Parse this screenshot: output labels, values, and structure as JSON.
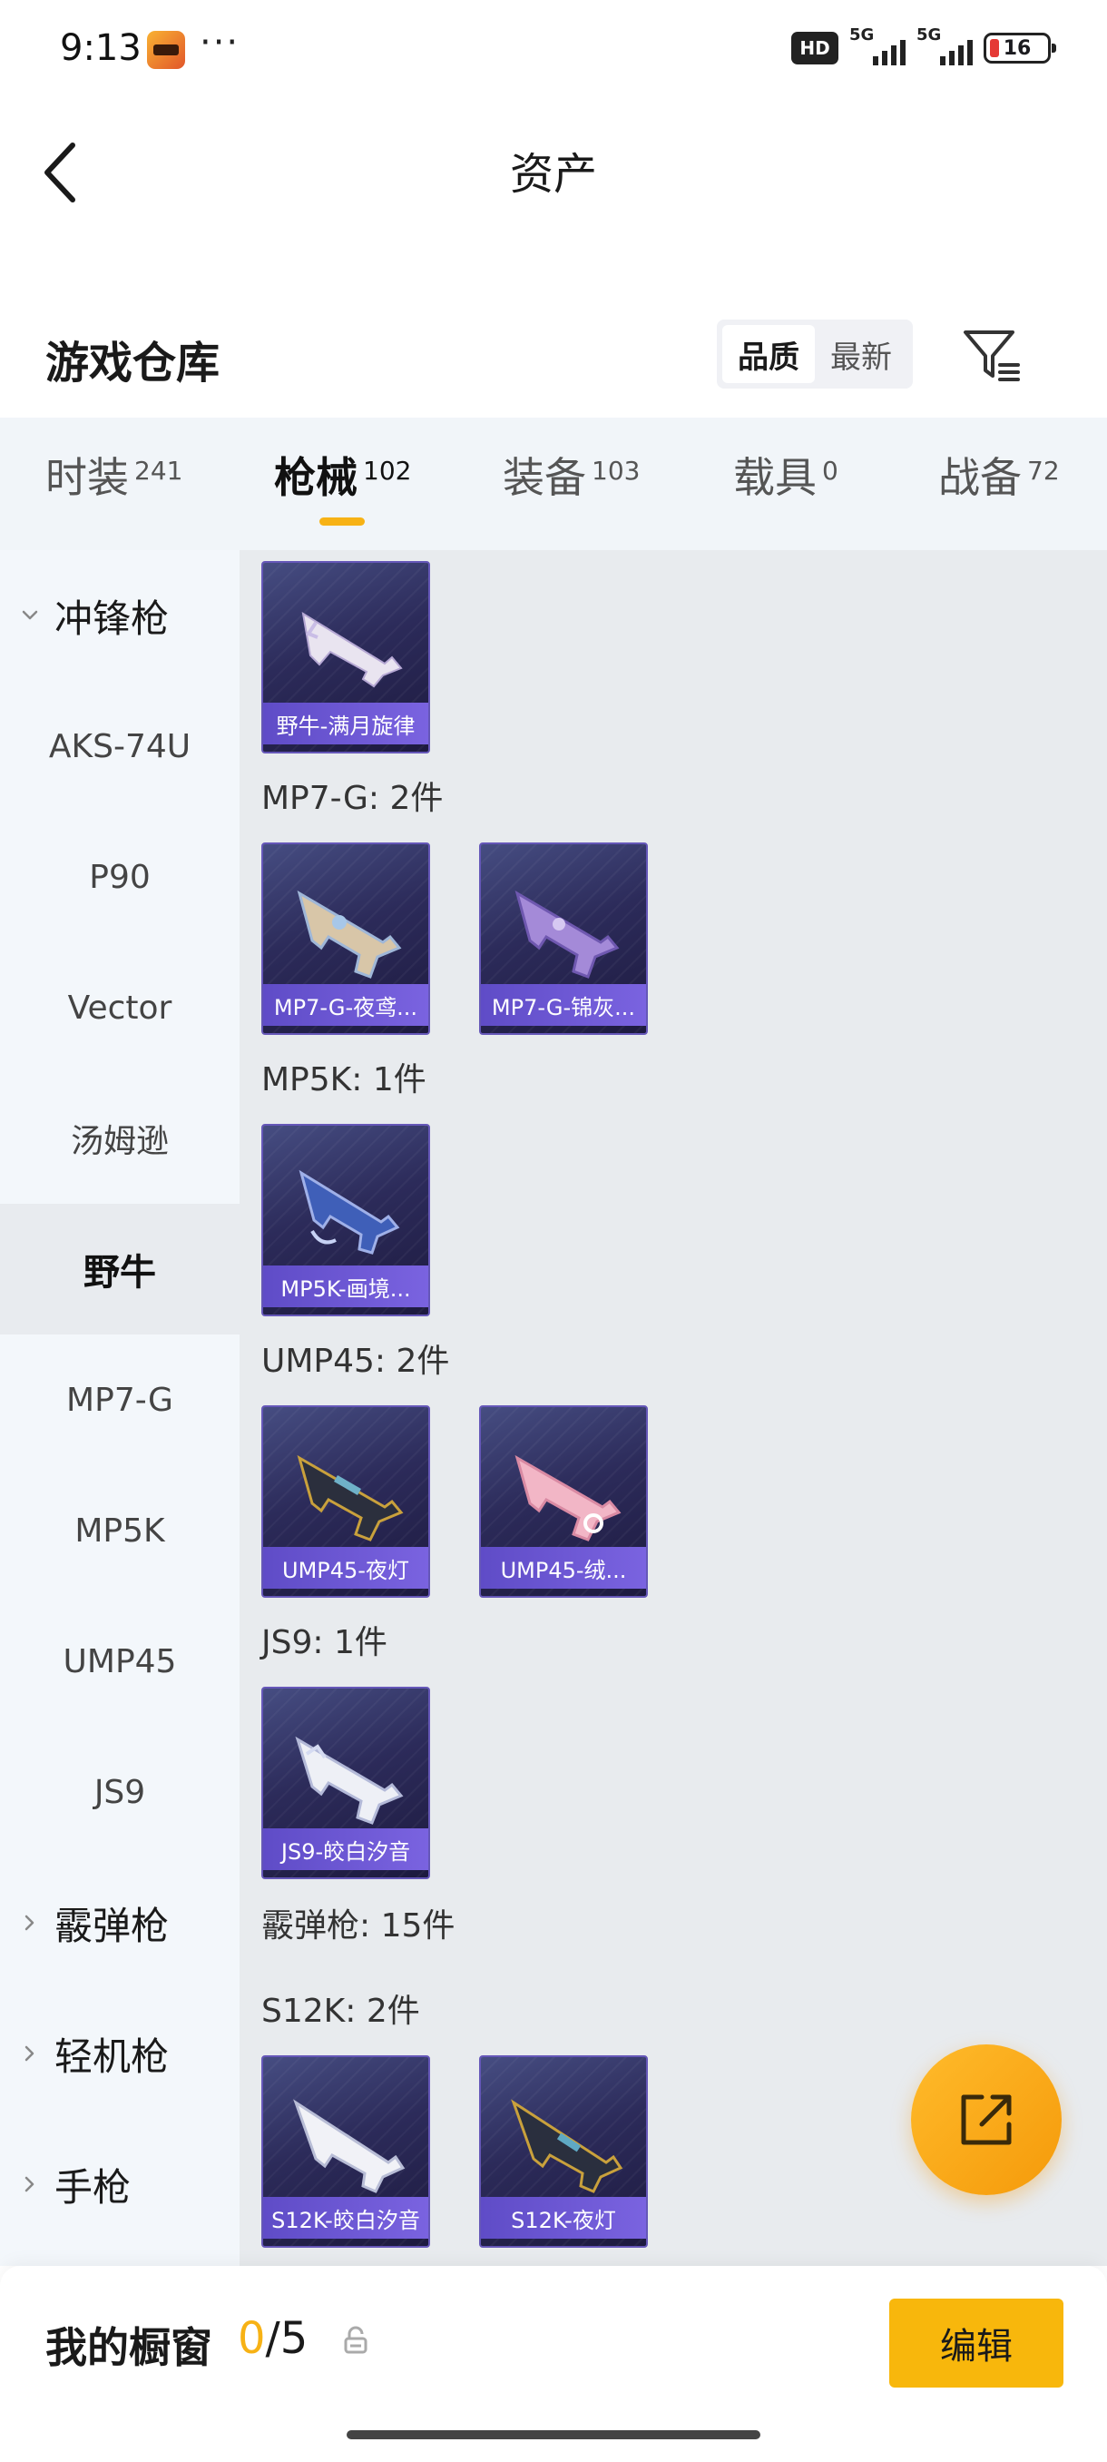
{
  "status_bar": {
    "time": "9:13",
    "dots": "···",
    "hd": "HD",
    "net1": "5G",
    "net2": "5G",
    "battery": "16"
  },
  "nav": {
    "title": "资产"
  },
  "section": {
    "title": "游戏仓库",
    "sort_options": [
      "品质",
      "最新"
    ],
    "active_sort": "品质"
  },
  "tabs": [
    {
      "label": "时装",
      "count": "241"
    },
    {
      "label": "枪械",
      "count": "102"
    },
    {
      "label": "装备",
      "count": "103"
    },
    {
      "label": "载具",
      "count": "0"
    },
    {
      "label": "战备",
      "count": "72"
    }
  ],
  "active_tab": "枪械",
  "sidebar": {
    "items": [
      {
        "label": "冲锋枪",
        "type": "group",
        "expanded": true
      },
      {
        "label": "AKS-74U",
        "type": "item"
      },
      {
        "label": "P90",
        "type": "item"
      },
      {
        "label": "Vector",
        "type": "item"
      },
      {
        "label": "汤姆逊",
        "type": "item"
      },
      {
        "label": "野牛",
        "type": "item",
        "selected": true
      },
      {
        "label": "MP7-G",
        "type": "item"
      },
      {
        "label": "MP5K",
        "type": "item"
      },
      {
        "label": "UMP45",
        "type": "item"
      },
      {
        "label": "JS9",
        "type": "item"
      },
      {
        "label": "霰弹枪",
        "type": "group",
        "expanded": false
      },
      {
        "label": "轻机枪",
        "type": "group",
        "expanded": false
      },
      {
        "label": "手枪",
        "type": "group",
        "expanded": false
      }
    ]
  },
  "content": {
    "groups": [
      {
        "label": "",
        "cards": [
          "野牛-满月旋律"
        ]
      },
      {
        "label": "MP7-G: 2件",
        "cards": [
          "MP7-G-夜鸢...",
          "MP7-G-锦灰..."
        ]
      },
      {
        "label": "MP5K: 1件",
        "cards": [
          "MP5K-画境..."
        ]
      },
      {
        "label": "UMP45: 2件",
        "cards": [
          "UMP45-夜灯",
          "UMP45-绒..."
        ]
      },
      {
        "label": "JS9: 1件",
        "cards": [
          "JS9-皎白汐音"
        ]
      },
      {
        "label": "霰弹枪: 15件",
        "cards": []
      },
      {
        "label": "S12K: 2件",
        "cards": [
          "S12K-皎白汐音",
          "S12K-夜灯"
        ]
      }
    ]
  },
  "bottom_bar": {
    "title": "我的橱窗",
    "current": "0",
    "total": "/5",
    "edit_label": "编辑"
  },
  "colors": {
    "accent": "#f7b215",
    "card_bg": "#2c2b5a",
    "card_label": "#6a55d4",
    "content_bg": "#e8ebee",
    "sidebar_bg": "#f3f7fb"
  }
}
